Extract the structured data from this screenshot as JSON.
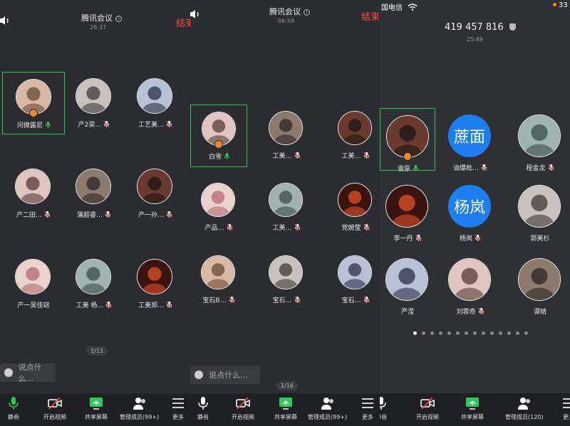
{
  "p1": {
    "title": "腾讯会议",
    "time": "26:37",
    "end": "结束",
    "tiles": [
      {
        "name": "闫微露尼",
        "active": true,
        "host": true,
        "mic": "on"
      },
      {
        "name": "产2梁…",
        "mic": "off"
      },
      {
        "name": "工艺美…",
        "mic": "off"
      },
      {
        "name": "产二田…",
        "mic": "off"
      },
      {
        "name": "蒲超睿…",
        "mic": "off"
      },
      {
        "name": "产一孙…",
        "mic": "off"
      },
      {
        "name": "产一吴佳窈",
        "mic": "none"
      },
      {
        "name": "工美 杨…",
        "mic": "off"
      },
      {
        "name": "工美郑…",
        "mic": "off"
      }
    ],
    "page": "1/12",
    "chat_placeholder": "说点什么...",
    "toolbar": [
      "静音",
      "开启视频",
      "共享屏幕",
      "管理成员(99+)",
      "更多"
    ]
  },
  "p2": {
    "title": "腾讯会议",
    "time": "06:58",
    "end": "结束",
    "tiles": [
      {
        "name": "白雪",
        "active": true,
        "host": true,
        "mic": "on"
      },
      {
        "name": "工美…",
        "mic": "off"
      },
      {
        "name": "工美…",
        "mic": "off"
      },
      {
        "name": "产品…",
        "mic": "off"
      },
      {
        "name": "工美…",
        "mic": "off"
      },
      {
        "name": "党婉莹",
        "mic": "off"
      },
      {
        "name": "宝石B…",
        "mic": "off"
      },
      {
        "name": "宝石…",
        "mic": "off"
      },
      {
        "name": "宝石…",
        "mic": "off"
      }
    ],
    "page": "1/16",
    "chat_placeholder": "说点什么...",
    "toolbar": [
      "静音",
      "开启视频",
      "共享屏幕",
      "管理成员(99+)",
      "更多"
    ]
  },
  "p3": {
    "carrier": "国电信",
    "battery": "33",
    "meeting_id": "419 457 816",
    "time": "25:49",
    "tiles": [
      {
        "name": "雪原",
        "active": true,
        "host": true,
        "mic": "on"
      },
      {
        "name": "油爆枇…",
        "mic": "off",
        "avatar_text": "蔗面"
      },
      {
        "name": "程金龙",
        "mic": "off"
      },
      {
        "name": "李一丹",
        "mic": "off"
      },
      {
        "name": "杨岚",
        "mic": "off",
        "avatar_text": "杨岚"
      },
      {
        "name": "郭美杉",
        "mic": "none"
      },
      {
        "name": "严滢",
        "mic": "none"
      },
      {
        "name": "刘蓉奇",
        "mic": "off"
      },
      {
        "name": "谭婧",
        "mic": "none"
      }
    ],
    "toolbar": [
      "静音",
      "开启视频",
      "共享屏幕",
      "管理成员(120)",
      "更多"
    ],
    "dot_count": 14
  },
  "colors": {
    "accent_green": "#2fc85e",
    "end_red": "#ff4a4a",
    "host_orange": "#f0892d",
    "text_avatar_blue": "#1f7df2"
  }
}
